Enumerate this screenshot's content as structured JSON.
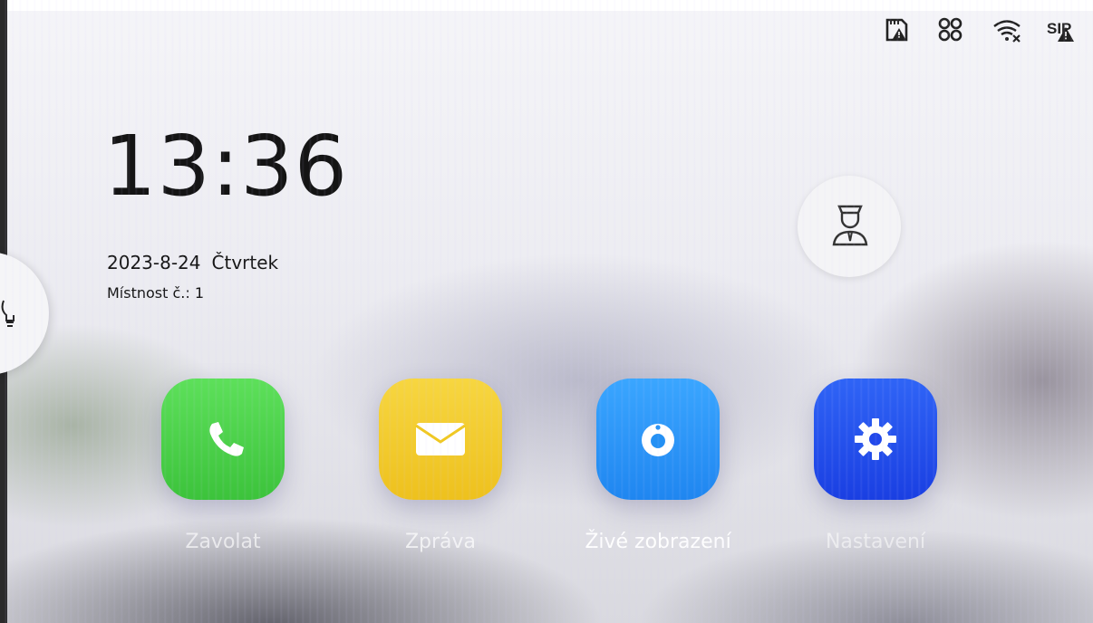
{
  "status_bar": {
    "icons": [
      "sd-card-alert-icon",
      "network-icon",
      "wifi-off-icon",
      "sip-alert-icon"
    ]
  },
  "clock": {
    "time": "13:36"
  },
  "date": {
    "date": "2023-8-24",
    "weekday": "Čtvrtek"
  },
  "room": {
    "label": "Místnost č.: 1"
  },
  "side_handle": {
    "icon": "bulb-icon"
  },
  "guard": {
    "icon": "guard-icon"
  },
  "apps": [
    {
      "label": "Zavolat",
      "icon": "phone-icon",
      "color": "#4ad248"
    },
    {
      "label": "Zpráva",
      "icon": "envelope-icon",
      "color": "#f2cb2a"
    },
    {
      "label": "Živé zobrazení",
      "icon": "camera-icon",
      "color": "#2896f8"
    },
    {
      "label": "Nastavení",
      "icon": "gear-icon",
      "color": "#2450ec"
    }
  ]
}
